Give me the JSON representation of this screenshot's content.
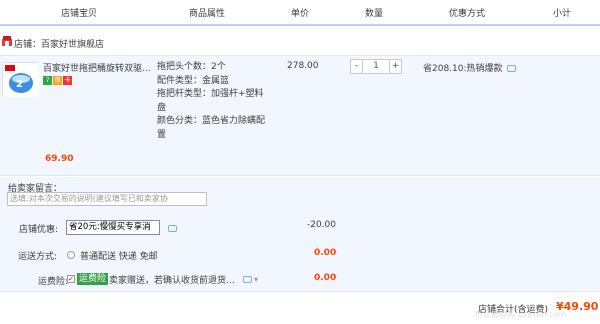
{
  "columns": [
    "店铺宝贝",
    "商品属性",
    "单价",
    "数量",
    "优惠方式",
    "小计"
  ],
  "store": {
    "label": "店铺：百家好世旗舰店"
  },
  "item": {
    "title": "百家好世拖把桶旋转双驱...",
    "attributes": [
      "拖把头个数：2个",
      "配件类型：金属篮",
      "拖把杆类型：加强杆+塑料",
      "盘",
      "颜色分类：蓝色省力除螨配",
      "置"
    ],
    "unit_price": "278.00",
    "quantity": "1",
    "minus": "-",
    "plus": "+",
    "discount": "省208.10:热销爆款",
    "subtotal": "69.90",
    "badges": [
      "7",
      "保",
      "卡"
    ]
  },
  "memo": {
    "label": "给卖家留言：",
    "placeholder": "选填:对本次交易的说明(建议填写已和卖家协"
  },
  "coupon": {
    "label": "店铺优惠:",
    "selected": "省20元:慢慢买专享消",
    "value": "-20.00"
  },
  "shipping": {
    "label": "运送方式:",
    "option": "普通配送 快递 免邮",
    "value": "0.00"
  },
  "insurance": {
    "label": "运费险:",
    "tag": "运费险",
    "text": "卖家赠送，若确认收货前退货...",
    "value": "0.00"
  },
  "footer": {
    "shop_total_label": "店铺合计(含运费)",
    "shop_total_value": "¥49.90"
  },
  "watermark": "什么值得买 smzdm.com",
  "colors": {
    "accent_red": "#ff4400",
    "header_border": "#b2d1ff",
    "row_bg": "#f2f7ff",
    "tag_green": "#35a047"
  }
}
